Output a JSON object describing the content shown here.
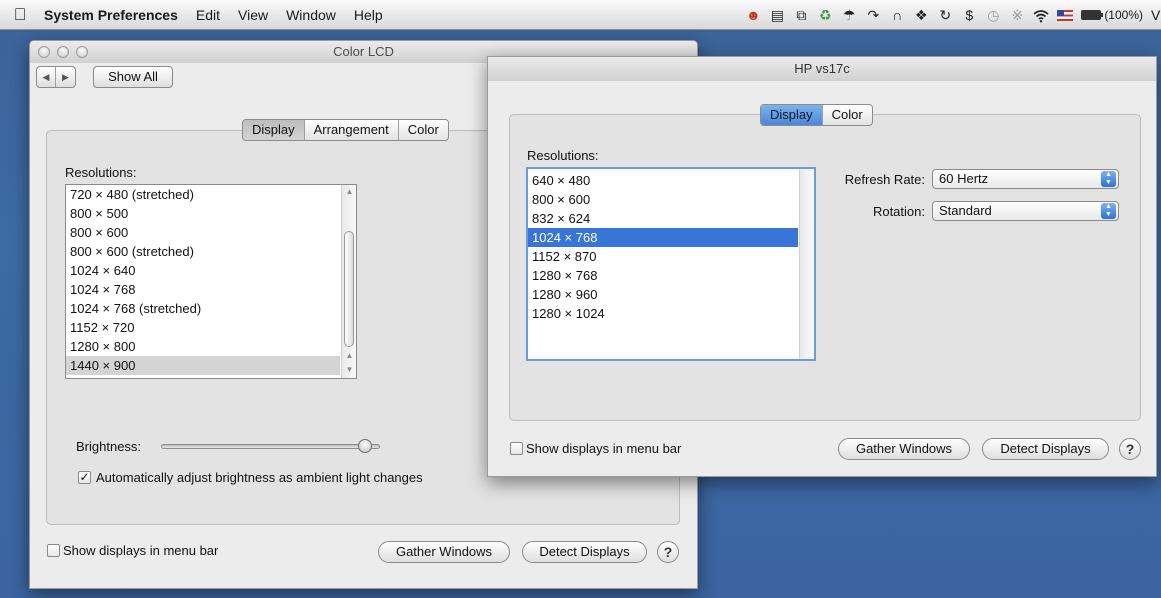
{
  "menubar": {
    "app_name": "System Preferences",
    "menus": [
      "Edit",
      "View",
      "Window",
      "Help"
    ],
    "battery_text": "(100%)",
    "user_initial": "V",
    "status_icons": [
      "user-icon",
      "script-icon",
      "time-machine-sync-icon",
      "recycle-icon",
      "umbrella-icon",
      "sync-arrow-icon",
      "bag-icon",
      "evernote-icon",
      "refresh-icon",
      "dollar-icon",
      "clock-icon",
      "bluetooth-icon",
      "wifi-icon",
      "flag-icon",
      "battery-icon"
    ]
  },
  "color_lcd": {
    "title": "Color LCD",
    "show_all_label": "Show All",
    "tabs": [
      "Display",
      "Arrangement",
      "Color"
    ],
    "selected_tab": "Display",
    "resolutions_label": "Resolutions:",
    "resolutions": [
      "720 × 480 (stretched)",
      "800 × 500",
      "800 × 600",
      "800 × 600 (stretched)",
      "1024 × 640",
      "1024 × 768",
      "1024 × 768 (stretched)",
      "1152 × 720",
      "1280 × 800",
      "1440 × 900"
    ],
    "selected_resolution": "1440 × 900",
    "brightness_label": "Brightness:",
    "brightness_level": 0.93,
    "auto_brightness_label": "Automatically adjust brightness as ambient light changes",
    "auto_brightness_checked": true,
    "show_in_menu_bar_label": "Show displays in menu bar",
    "show_in_menu_bar_checked": false,
    "gather_windows_label": "Gather Windows",
    "detect_displays_label": "Detect Displays",
    "help_label": "?"
  },
  "hp_window": {
    "title": "HP vs17c",
    "tabs": [
      "Display",
      "Color"
    ],
    "selected_tab": "Display",
    "resolutions_label": "Resolutions:",
    "resolutions": [
      "640 × 480",
      "800 × 600",
      "832 × 624",
      "1024 × 768",
      "1152 × 870",
      "1280 × 768",
      "1280 × 960",
      "1280 × 1024"
    ],
    "selected_resolution": "1024 × 768",
    "refresh_rate_label": "Refresh Rate:",
    "refresh_rate_value": "60 Hertz",
    "rotation_label": "Rotation:",
    "rotation_value": "Standard",
    "show_in_menu_bar_label": "Show displays in menu bar",
    "show_in_menu_bar_checked": false,
    "gather_windows_label": "Gather Windows",
    "detect_displays_label": "Detect Displays",
    "help_label": "?"
  },
  "colors": {
    "desktop": "#3c6398",
    "selection_blue": "#3875d7",
    "selection_grey": "#d4d4d4"
  }
}
